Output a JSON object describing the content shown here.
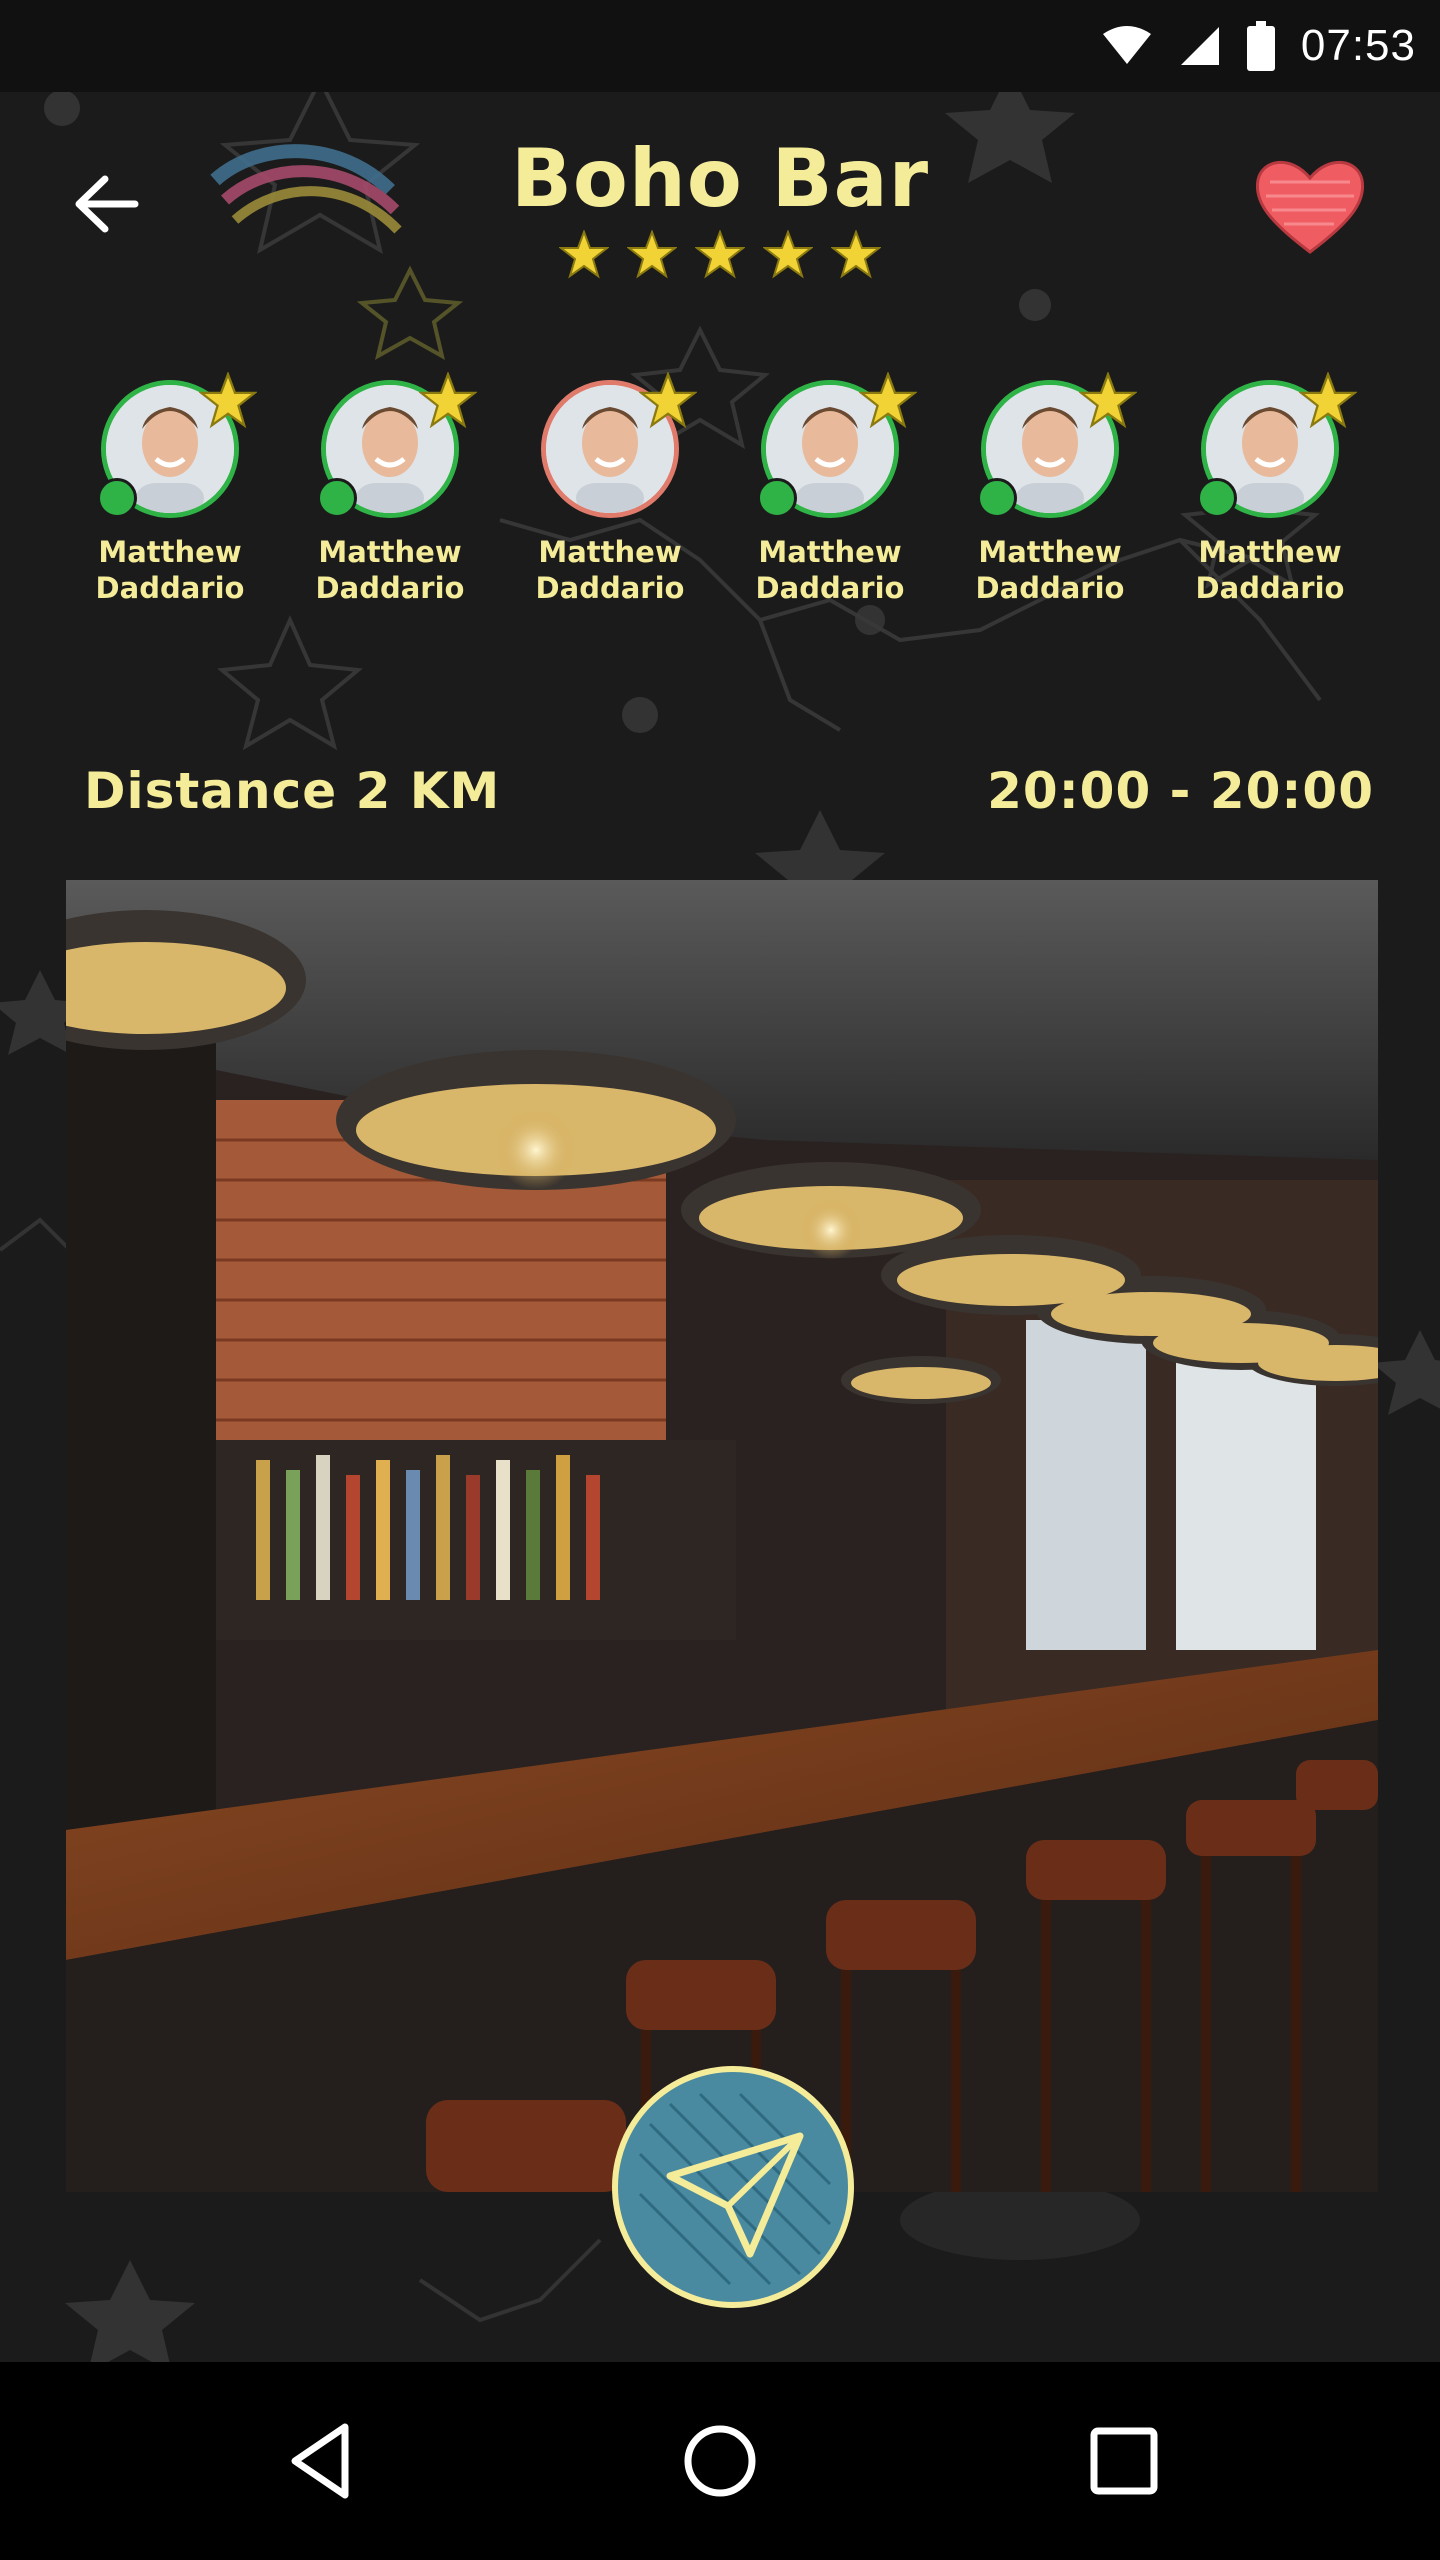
{
  "status_bar": {
    "time": "07:53",
    "icons": [
      "wifi-icon",
      "signal-icon",
      "battery-icon"
    ]
  },
  "header": {
    "title": "Boho Bar",
    "rating": 5,
    "back_icon": "arrow-left-icon",
    "favorite_icon": "heart-icon"
  },
  "friends": [
    {
      "name": "Matthew Daddario",
      "status": "online"
    },
    {
      "name": "Matthew Daddario",
      "status": "online"
    },
    {
      "name": "Matthew Daddario",
      "status": "away"
    },
    {
      "name": "Matthew Daddario",
      "status": "online"
    },
    {
      "name": "Matthew Daddario",
      "status": "online"
    },
    {
      "name": "Matthew Daddario",
      "status": "online"
    }
  ],
  "info": {
    "distance": "Distance 2 KM",
    "hours": "20:00 - 20:00"
  },
  "photo": {
    "subject": "bar interior"
  },
  "send_icon": "paper-plane-icon",
  "nav": {
    "back_icon": "triangle-back-icon",
    "home_icon": "circle-home-icon",
    "recent_icon": "square-recent-icon"
  },
  "colors": {
    "accent": "#f5ec9a",
    "online": "#2fb347",
    "away": "#e07b6c",
    "heart": "#ef5d63",
    "send": "#4a8aa0"
  }
}
